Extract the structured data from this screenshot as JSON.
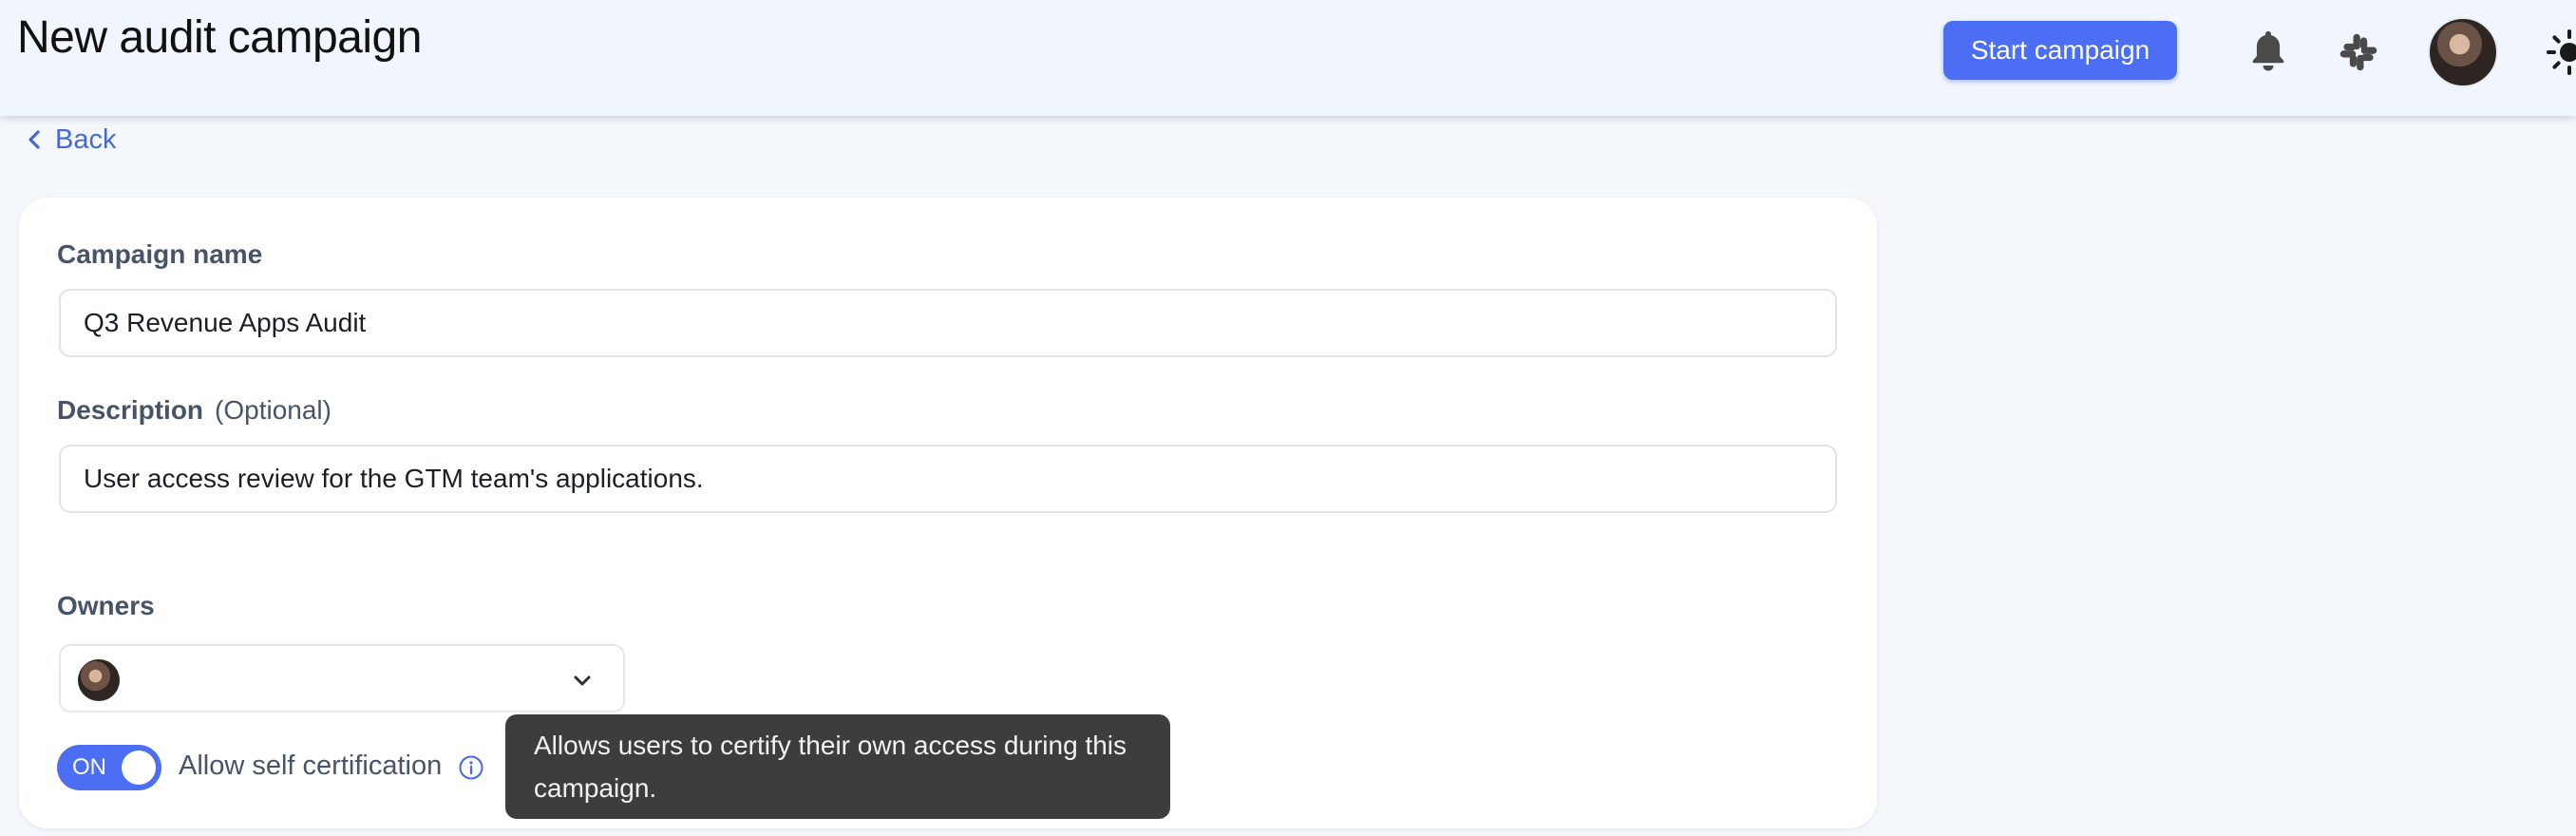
{
  "header": {
    "title": "New audit campaign",
    "start_button": "Start campaign",
    "icons": [
      "bell-icon",
      "slack-icon",
      "user-avatar",
      "theme-toggle-icon"
    ]
  },
  "nav": {
    "back_label": "Back"
  },
  "form": {
    "campaign_name": {
      "label": "Campaign name",
      "value": "Q3 Revenue Apps Audit"
    },
    "description": {
      "label": "Description",
      "optional": "(Optional)",
      "value": "User access review for the GTM team's applications."
    },
    "owners": {
      "label": "Owners"
    },
    "self_certification": {
      "toggle_state": "ON",
      "label": "Allow self certification",
      "tooltip": "Allows users to certify their own access during this campaign."
    }
  },
  "colors": {
    "accent": "#4c6ef5",
    "link": "#4569d6",
    "header_bg": "#f1f5fd",
    "page_bg": "#f4f7fc",
    "tooltip_bg": "#3d3d3d"
  }
}
